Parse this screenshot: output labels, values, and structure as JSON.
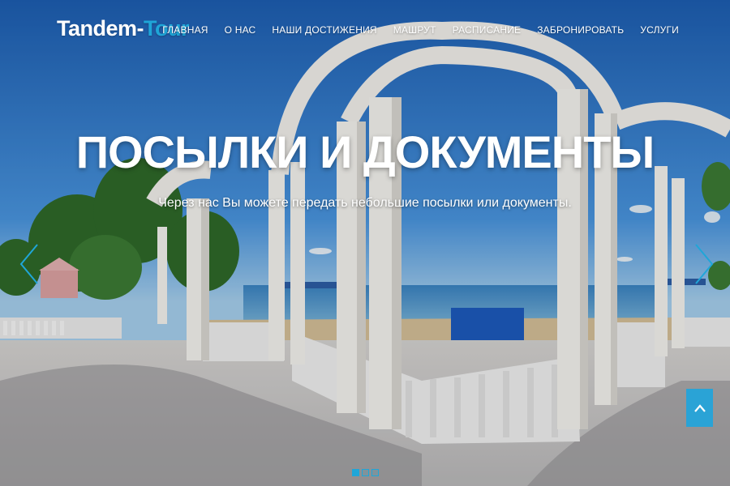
{
  "brand": {
    "part1": "Tandem-",
    "part2": "Tour"
  },
  "nav": {
    "items": [
      {
        "label": "ГЛАВНАЯ"
      },
      {
        "label": "О НАС"
      },
      {
        "label": "НАШИ ДОСТИЖЕНИЯ"
      },
      {
        "label": "МАШРУТ"
      },
      {
        "label": "РАСПИСАНИЕ"
      },
      {
        "label": "ЗАБРОНИРОВАТЬ"
      },
      {
        "label": "УСЛУГИ"
      }
    ]
  },
  "hero": {
    "title": "ПОСЫЛКИ И ДОКУМЕНТЫ",
    "subtitle": "Через нас Вы можете передать небольшие посылки или документы."
  },
  "carousel": {
    "slides": 3,
    "active": 1
  },
  "icons": {
    "prev": "chevron-left-icon",
    "next": "chevron-right-icon",
    "top": "arrow-up-icon"
  },
  "colors": {
    "accent": "#1fa6d8",
    "button": "#2aa3d6"
  }
}
